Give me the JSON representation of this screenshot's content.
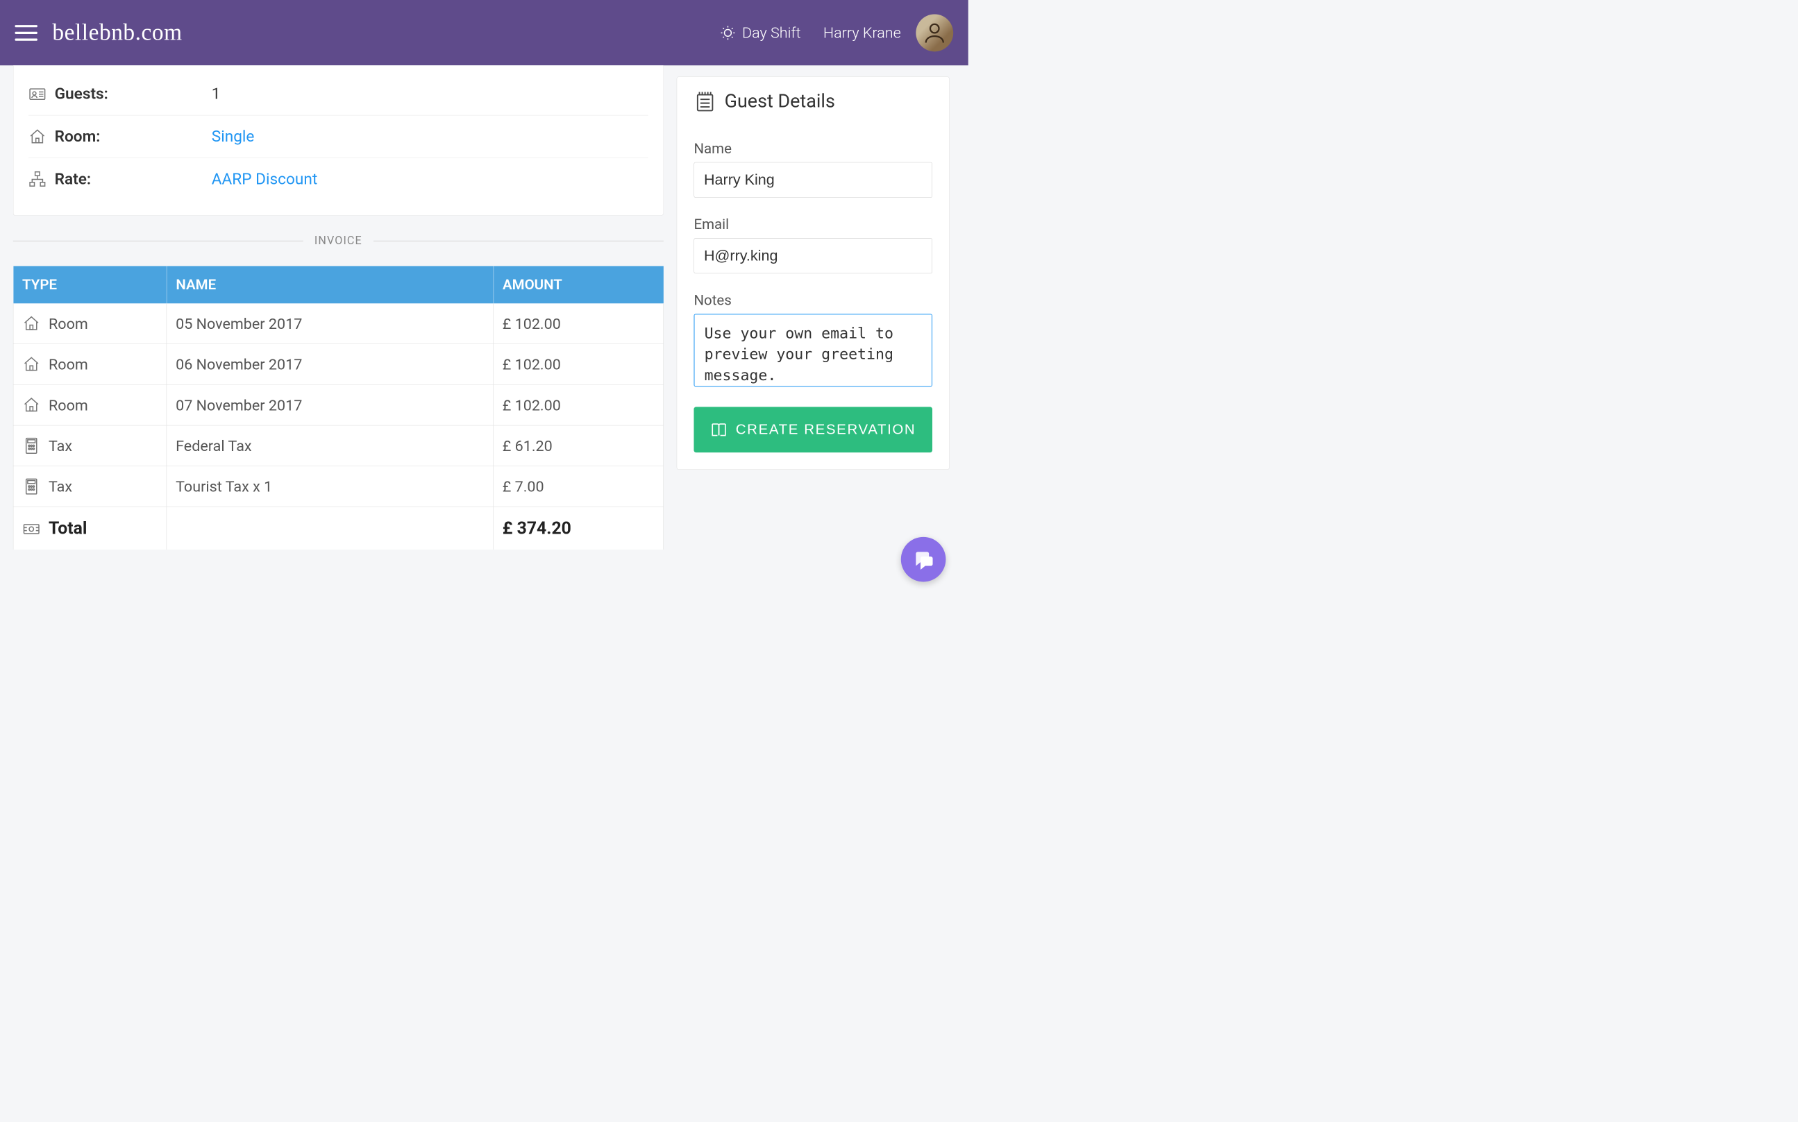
{
  "header": {
    "brand": "bellebnb.com",
    "shift_label": "Day Shift",
    "user_name": "Harry Krane"
  },
  "booking": {
    "guests": {
      "label": "Guests:",
      "value": "1"
    },
    "room": {
      "label": "Room:",
      "value": "Single"
    },
    "rate": {
      "label": "Rate:",
      "value": "AARP Discount"
    }
  },
  "invoice": {
    "section_label": "INVOICE",
    "columns": {
      "type": "TYPE",
      "name": "NAME",
      "amount": "AMOUNT"
    },
    "rows": [
      {
        "type_icon": "house",
        "type": "Room",
        "name": "05 November 2017",
        "amount": "£ 102.00"
      },
      {
        "type_icon": "house",
        "type": "Room",
        "name": "06 November 2017",
        "amount": "£ 102.00"
      },
      {
        "type_icon": "house",
        "type": "Room",
        "name": "07 November 2017",
        "amount": "£ 102.00"
      },
      {
        "type_icon": "calculator",
        "type": "Tax",
        "name": "Federal Tax",
        "amount": "£ 61.20"
      },
      {
        "type_icon": "calculator",
        "type": "Tax",
        "name": "Tourist Tax x 1",
        "amount": "£ 7.00"
      }
    ],
    "total": {
      "type_icon": "cash",
      "type_label": "Total",
      "amount": "£ 374.20"
    }
  },
  "guest_details": {
    "title": "Guest Details",
    "name_label": "Name",
    "name_value": "Harry King",
    "email_label": "Email",
    "email_value": "H@rry.king",
    "notes_label": "Notes",
    "notes_value": "Use your own email to preview your greeting message.",
    "create_button": "CREATE RESERVATION"
  }
}
